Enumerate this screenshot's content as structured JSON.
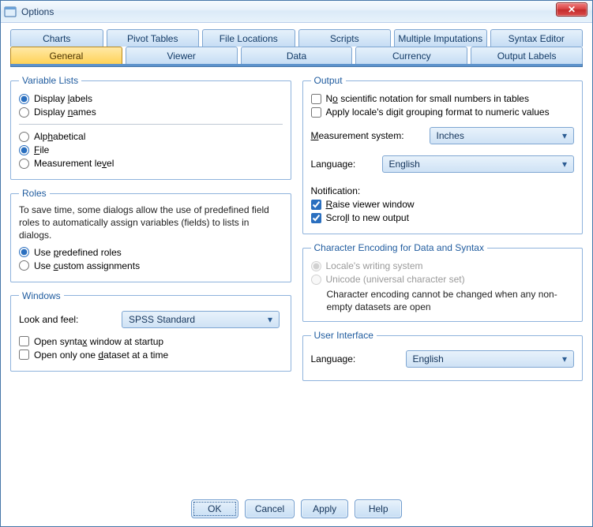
{
  "window": {
    "title": "Options",
    "close_symbol": "✕"
  },
  "tabs_row1": [
    {
      "label": "Charts"
    },
    {
      "label": "Pivot Tables"
    },
    {
      "label": "File Locations"
    },
    {
      "label": "Scripts"
    },
    {
      "label": "Multiple Imputations"
    },
    {
      "label": "Syntax Editor"
    }
  ],
  "tabs_row2": [
    {
      "label": "General",
      "active": true
    },
    {
      "label": "Viewer"
    },
    {
      "label": "Data"
    },
    {
      "label": "Currency"
    },
    {
      "label": "Output Labels"
    }
  ],
  "left": {
    "variable_lists": {
      "legend": "Variable Lists",
      "display_labels_pre": "Display ",
      "display_labels_u": "l",
      "display_labels_post": "abels",
      "display_names_pre": "Display ",
      "display_names_u": "n",
      "display_names_post": "ames",
      "alpha_pre": "Alp",
      "alpha_u": "h",
      "alpha_post": "abetical",
      "file_u": "F",
      "file_post": "ile",
      "measure_pre": "Measurement le",
      "measure_u": "v",
      "measure_post": "el"
    },
    "roles": {
      "legend": "Roles",
      "note": "To save time, some dialogs allow the use of predefined field roles to automatically assign variables (fields) to lists in dialogs.",
      "predef_pre": "Use ",
      "predef_u": "p",
      "predef_post": "redefined roles",
      "custom_pre": "Use ",
      "custom_u": "c",
      "custom_post": "ustom assignments"
    },
    "windows": {
      "legend": "Windows",
      "look_lbl": "Look and feel:",
      "look_value": "SPSS Standard",
      "syntax_pre": "Open synta",
      "syntax_u": "x",
      "syntax_post": " window at startup",
      "one_ds_pre": "Open only one ",
      "one_ds_u": "d",
      "one_ds_post": "ataset at a time"
    }
  },
  "right": {
    "output": {
      "legend": "Output",
      "sci_pre": "N",
      "sci_u": "o",
      "sci_post": " scientific notation for small numbers in tables",
      "grp_label": "Apply locale's digit  grouping format to numeric values",
      "meas_lbl_u": "M",
      "meas_lbl_post": "easurement system:",
      "meas_value": "Inches",
      "lang_lbl": "Language:",
      "lang_value": "English",
      "notif_lbl": "Notification:",
      "raise_u": "R",
      "raise_post": "aise viewer window",
      "scroll_pre": "Scro",
      "scroll_u": "l",
      "scroll_post": "l to new output"
    },
    "enc": {
      "legend": "Character Encoding for Data and Syntax",
      "locale_label": "Locale's writing system",
      "unicode_label": "Unicode (universal character set)",
      "info": "Character encoding cannot be changed when any non-empty datasets are open"
    },
    "ui": {
      "legend": "User Interface",
      "lang_lbl": "Language:",
      "lang_value": "English"
    }
  },
  "buttons": {
    "ok": "OK",
    "cancel": "Cancel",
    "apply": "Apply",
    "help": "Help"
  }
}
